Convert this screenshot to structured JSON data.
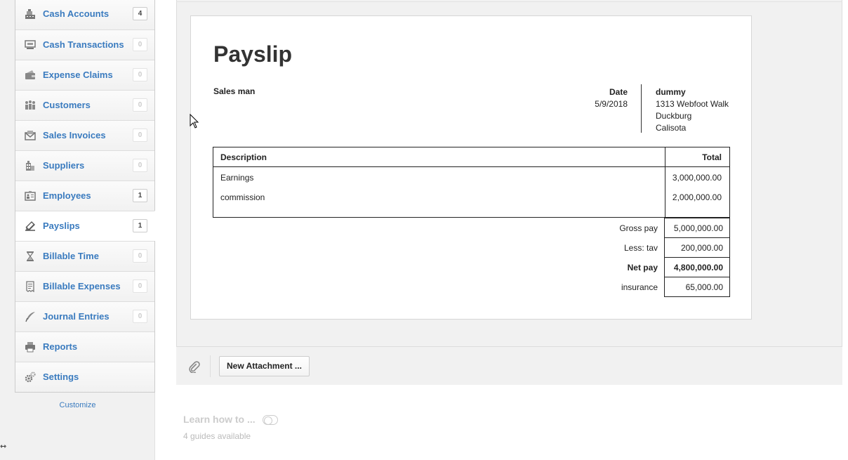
{
  "sidebar": {
    "items": [
      {
        "label": "Cash Accounts",
        "count": "4",
        "icon": "cash-register-icon"
      },
      {
        "label": "Cash Transactions",
        "count": "0",
        "icon": "transactions-icon"
      },
      {
        "label": "Expense Claims",
        "count": "0",
        "icon": "wallet-icon"
      },
      {
        "label": "Customers",
        "count": "0",
        "icon": "customers-icon"
      },
      {
        "label": "Sales Invoices",
        "count": "0",
        "icon": "envelope-icon"
      },
      {
        "label": "Suppliers",
        "count": "0",
        "icon": "building-icon"
      },
      {
        "label": "Employees",
        "count": "1",
        "icon": "id-card-icon"
      },
      {
        "label": "Payslips",
        "count": "1",
        "icon": "pen-paper-icon"
      },
      {
        "label": "Billable Time",
        "count": "0",
        "icon": "hourglass-icon"
      },
      {
        "label": "Billable Expenses",
        "count": "0",
        "icon": "receipt-icon"
      },
      {
        "label": "Journal Entries",
        "count": "0",
        "icon": "quill-icon"
      },
      {
        "label": "Reports",
        "icon": "printer-icon"
      },
      {
        "label": "Settings",
        "icon": "gears-icon"
      }
    ],
    "active": "Payslips",
    "customize_label": "Customize",
    "collapse_glyph": "⇿"
  },
  "payslip": {
    "title": "Payslip",
    "employee": "Sales man",
    "date_label": "Date",
    "date_value": "5/9/2018",
    "company": {
      "name": "dummy",
      "address_line1": "1313 Webfoot Walk",
      "address_line2": "Duckburg",
      "address_line3": "Calisota"
    },
    "table": {
      "col_description": "Description",
      "col_total": "Total",
      "rows": [
        {
          "description": "Earnings",
          "total": "3,000,000.00"
        },
        {
          "description": "commission",
          "total": "2,000,000.00"
        }
      ]
    },
    "summary": {
      "gross_label": "Gross pay",
      "gross_value": "5,000,000.00",
      "less_label": "Less: tav",
      "less_value": "200,000.00",
      "net_label": "Net pay",
      "net_value": "4,800,000.00",
      "insurance_label": "insurance",
      "insurance_value": "65,000.00"
    }
  },
  "attachments": {
    "new_button_label": "New Attachment ..."
  },
  "learn": {
    "label": "Learn how to ...",
    "guides_text": "4 guides available"
  },
  "colors": {
    "link_blue": "#3a7bbf",
    "sidebar_bg": "#f1f1f1",
    "panel_bg": "#f1f1f1"
  }
}
